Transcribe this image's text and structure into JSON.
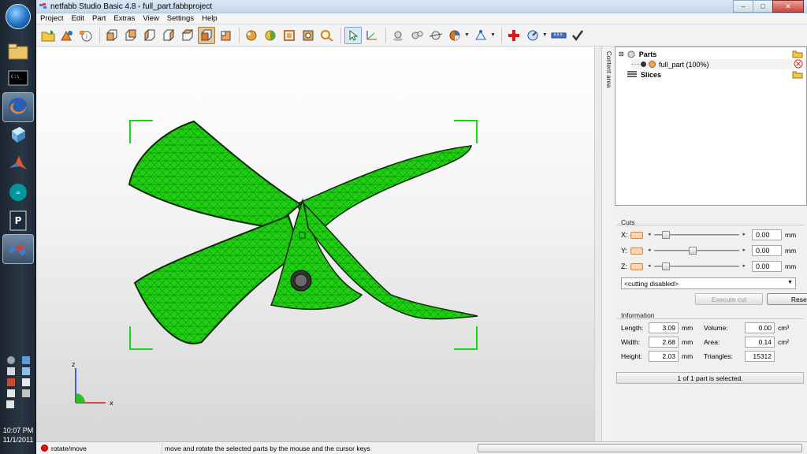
{
  "window": {
    "title": "netfabb Studio Basic 4.8 - full_part.fabbproject",
    "controls": {
      "minimize": "–",
      "maximize": "□",
      "close": "✕"
    }
  },
  "menu": [
    "Project",
    "Edit",
    "Part",
    "Extras",
    "View",
    "Settings",
    "Help"
  ],
  "toolbar": {
    "icons": [
      "open-folder-icon",
      "add-part-icon",
      "part-info-icon",
      "view-front-icon",
      "view-back-icon",
      "view-left-icon",
      "view-right-icon",
      "view-top-icon",
      "view-bottom-icon",
      "view-perspective-icon",
      "repair-icon",
      "shade-icon",
      "frame-icon",
      "zoom-icon",
      "select-arrow-icon",
      "rotate-icon",
      "move-icon",
      "scale-icon",
      "cut-icon",
      "pie-chart-icon",
      "measure-icon",
      "add-red-cross-icon",
      "gauge-icon",
      "ruler-icon",
      "checkmark-icon"
    ]
  },
  "sidebar_label": "Content area",
  "tree": {
    "parts_label": "Parts",
    "part_name": "full_part (100%)",
    "slices_label": "Slices"
  },
  "cuts": {
    "title": "Cuts",
    "axes": [
      {
        "label": "X:",
        "value": "0.00",
        "unit": "mm",
        "slider_fraction": 0.1
      },
      {
        "label": "Y:",
        "value": "0.00",
        "unit": "mm",
        "slider_fraction": 0.45
      },
      {
        "label": "Z:",
        "value": "0.00",
        "unit": "mm",
        "slider_fraction": 0.1
      }
    ],
    "mode": "<cutting disabled>",
    "execute_label": "Execute cut",
    "reset_label": "Reset"
  },
  "information": {
    "title": "Information",
    "length_label": "Length:",
    "length": "3.09",
    "length_unit": "mm",
    "width_label": "Width:",
    "width": "2.68",
    "width_unit": "mm",
    "height_label": "Height:",
    "height": "2.03",
    "height_unit": "mm",
    "volume_label": "Volume:",
    "volume": "0.00",
    "volume_unit": "cm³",
    "area_label": "Area:",
    "area": "0.14",
    "area_unit": "cm²",
    "triangles_label": "Triangles:",
    "triangles": "15312"
  },
  "selection_status": "1 of 1 part is selected.",
  "statusbar": {
    "mode": "rotate/move",
    "hint": "move and rotate the selected parts by the mouse and the cursor keys"
  },
  "axes_gizmo": {
    "x": "x",
    "z": "z"
  },
  "taskbar": {
    "time": "10:07 PM",
    "date": "11/1/2011",
    "apps": [
      "start-orb-icon",
      "file-explorer-icon",
      "command-prompt-icon",
      "firefox-icon",
      "3d-box-icon",
      "matlab-icon",
      "arduino-icon",
      "processing-icon",
      "netfabb-icon"
    ]
  },
  "colors": {
    "model_green": "#1ecf12",
    "selection_green": "#17d617",
    "mesh_line": "#0b4a06"
  }
}
